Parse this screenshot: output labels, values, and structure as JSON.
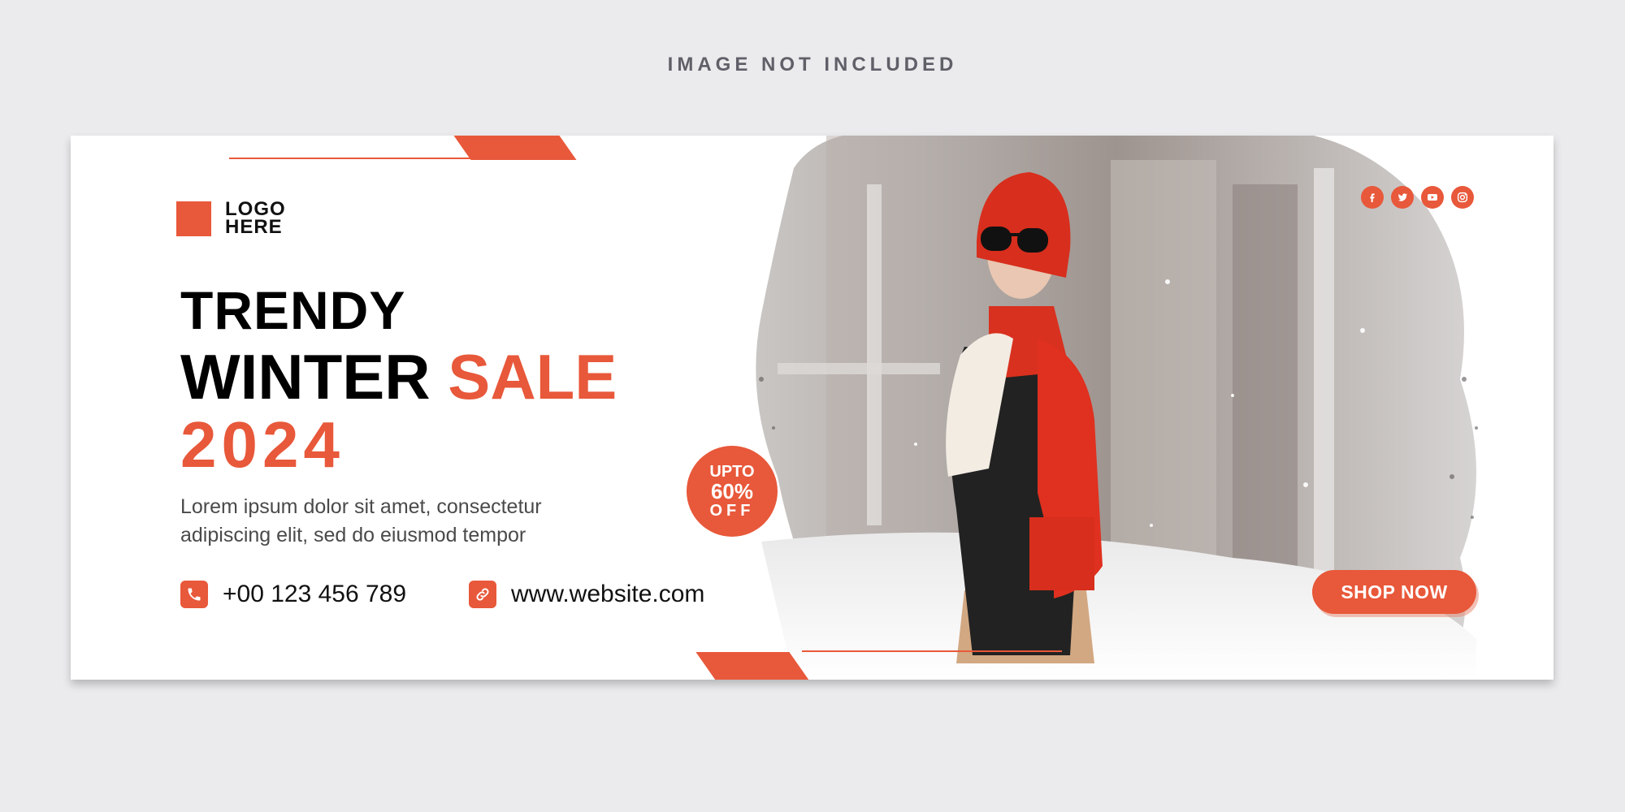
{
  "note": "IMAGE NOT INCLUDED",
  "logo": {
    "line1": "LOGO",
    "line2": "HERE"
  },
  "headline": {
    "line1": "TRENDY",
    "winter": "WINTER",
    "sale": "SALE",
    "year": "2024"
  },
  "description": {
    "line1": "Lorem ipsum dolor sit amet, consectetur",
    "line2": "adipiscing elit, sed do eiusmod tempor"
  },
  "contact": {
    "phone": "+00 123 456 789",
    "website": "www.website.com"
  },
  "badge": {
    "line1": "UPTO",
    "line2": "60%",
    "line3": "OFF"
  },
  "cta": {
    "label": "SHOP NOW"
  },
  "socials": [
    "facebook-icon",
    "twitter-icon",
    "youtube-icon",
    "instagram-icon"
  ],
  "colors": {
    "accent": "#e8583a",
    "background": "#ebebed",
    "text": "#000000"
  }
}
